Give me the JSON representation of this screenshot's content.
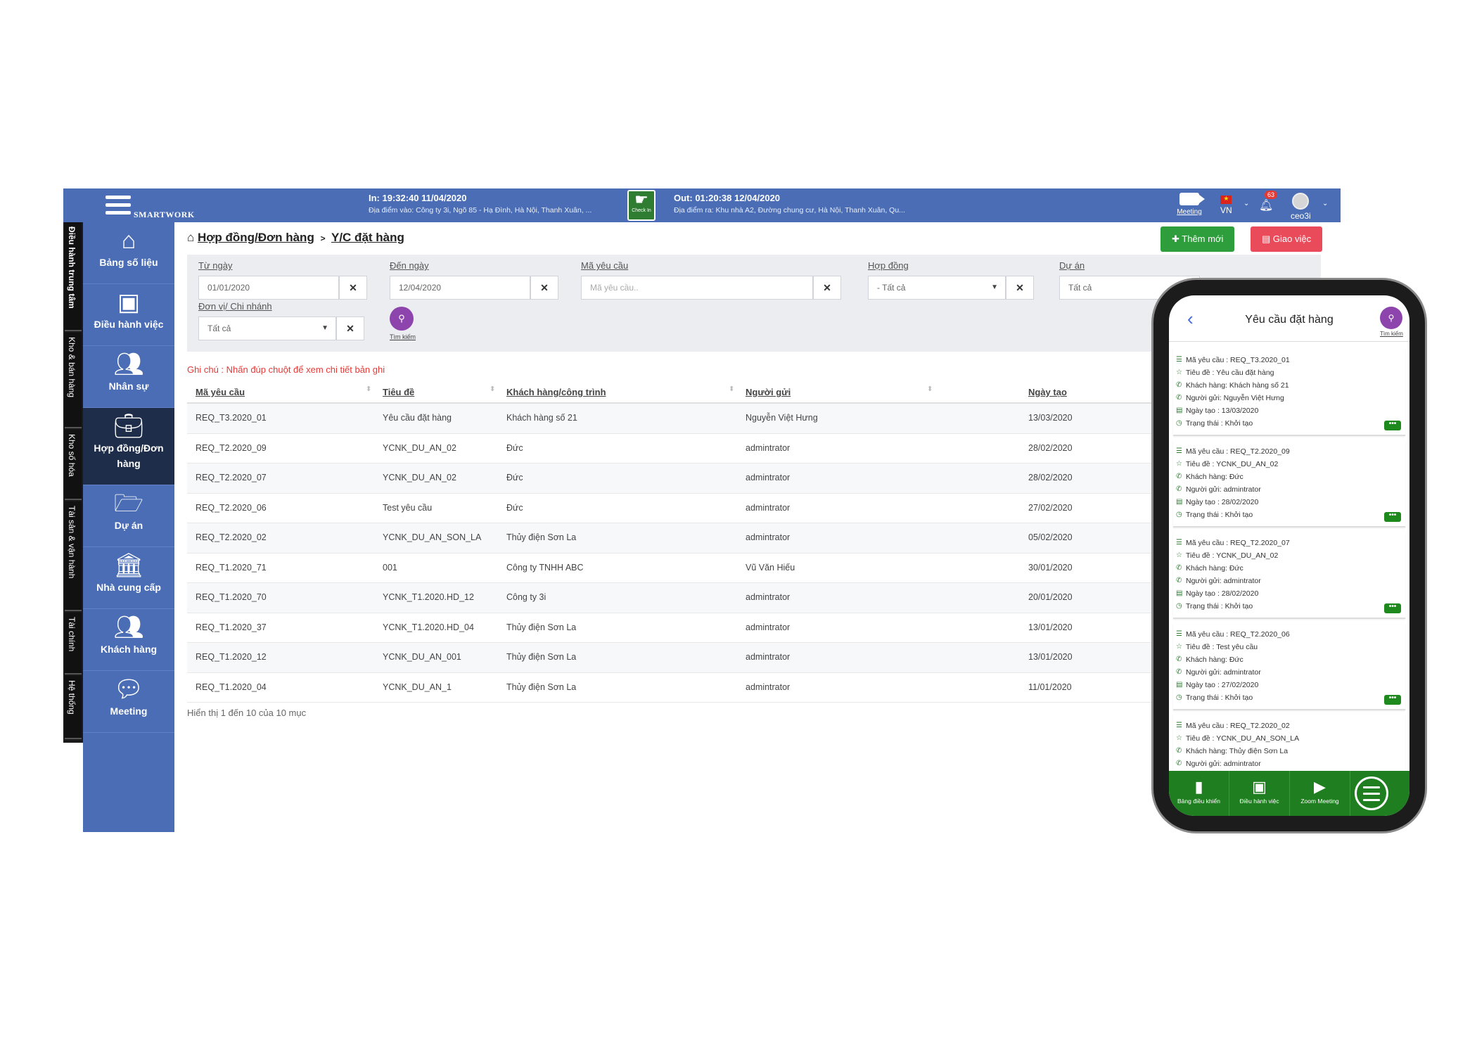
{
  "header": {
    "brand": "SMARTWORK",
    "checkin_in": "In: 19:32:40 11/04/2020",
    "checkin_in_place": "Địa điểm vào: Công ty 3i, Ngõ 85 - Hạ Đình, Hà Nội, Thanh Xuân, ...",
    "checkin_button": "Check In",
    "checkout_out": "Out: 01:20:38 12/04/2020",
    "checkout_place": "Địa điểm ra: Khu nhà A2, Đường chung cư, Hà Nội, Thanh Xuân, Qu...",
    "meeting": "Meeting",
    "lang": "VN",
    "notifications": "63",
    "user": "ceo3i"
  },
  "vertical_tabs": [
    "Điều hành trung tâm",
    "Kho & bán hàng",
    "Kho số hóa",
    "Tài sản & vận hành",
    "Tài chính",
    "Hệ thống"
  ],
  "sidebar": {
    "items": [
      {
        "label": "Bảng số liệu",
        "icon": "home-icon"
      },
      {
        "label": "Điều hành việc",
        "icon": "board-icon"
      },
      {
        "label": "Nhân sự",
        "icon": "users-icon"
      },
      {
        "label": "Hợp đồng/Đơn hàng",
        "icon": "briefcase-icon"
      },
      {
        "label": "Dự án",
        "icon": "folder-icon"
      },
      {
        "label": "Nhà cung cấp",
        "icon": "bank-icon"
      },
      {
        "label": "Khách hàng",
        "icon": "customers-icon"
      },
      {
        "label": "Meeting",
        "icon": "chat-icon"
      }
    ]
  },
  "breadcrumb": {
    "parent": "Hợp đồng/Đơn hàng",
    "current": "Y/C đặt hàng"
  },
  "actions": {
    "add": "Thêm mới",
    "assign": "Giao việc"
  },
  "filters": {
    "from_date_label": "Từ ngày",
    "from_date_value": "01/01/2020",
    "to_date_label": "Đến ngày",
    "to_date_value": "12/04/2020",
    "code_label": "Mã yêu cầu",
    "code_placeholder": "Mã yêu cầu..",
    "contract_label": "Hợp đồng",
    "contract_value": "- Tất cả",
    "project_label": "Dự án",
    "project_value": "Tất cả",
    "unit_label": "Đơn vị/ Chi nhánh",
    "unit_value": "Tất cả",
    "search_label": "Tìm kiếm"
  },
  "note": "Ghi chú : Nhấn đúp chuột để xem chi tiết bản ghi",
  "table": {
    "headers": [
      "Mã yêu cầu",
      "Tiêu đề",
      "Khách hàng/công trình",
      "Người gửi",
      "Ngày tạo"
    ],
    "rows": [
      [
        "REQ_T3.2020_01",
        "Yêu cầu đặt hàng",
        "Khách hàng số 21",
        "Nguyễn Việt Hưng",
        "13/03/2020"
      ],
      [
        "REQ_T2.2020_09",
        "YCNK_DU_AN_02",
        "Đức",
        "admintrator",
        "28/02/2020"
      ],
      [
        "REQ_T2.2020_07",
        "YCNK_DU_AN_02",
        "Đức",
        "admintrator",
        "28/02/2020"
      ],
      [
        "REQ_T2.2020_06",
        "Test yêu cầu",
        "Đức",
        "admintrator",
        "27/02/2020"
      ],
      [
        "REQ_T2.2020_02",
        "YCNK_DU_AN_SON_LA",
        "Thủy điện Sơn La",
        "admintrator",
        "05/02/2020"
      ],
      [
        "REQ_T1.2020_71",
        "001",
        "Công ty TNHH ABC",
        "Vũ Văn Hiếu",
        "30/01/2020"
      ],
      [
        "REQ_T1.2020_70",
        "YCNK_T1.2020.HD_12",
        "Công ty 3i",
        "admintrator",
        "20/01/2020"
      ],
      [
        "REQ_T1.2020_37",
        "YCNK_T1.2020.HD_04",
        "Thủy điện Sơn La",
        "admintrator",
        "13/01/2020"
      ],
      [
        "REQ_T1.2020_12",
        "YCNK_DU_AN_001",
        "Thủy điện Sơn La",
        "admintrator",
        "13/01/2020"
      ],
      [
        "REQ_T1.2020_04",
        "YCNK_DU_AN_1",
        "Thủy điện Sơn La",
        "admintrator",
        "11/01/2020"
      ]
    ]
  },
  "footer": "Hiển thị 1 đến 10 của 10 mục",
  "phone": {
    "title": "Yêu cầu đặt hàng",
    "search_label": "Tìm kiếm",
    "cards": [
      [
        "Mã yêu cầu : REQ_T3.2020_01",
        "Tiêu đề : Yêu cầu đặt hàng",
        "Khách hàng: Khách hàng số 21",
        "Người gửi: Nguyễn Việt Hưng",
        "Ngày tạo : 13/03/2020",
        "Trạng thái : Khởi tạo"
      ],
      [
        "Mã yêu cầu : REQ_T2.2020_09",
        "Tiêu đề : YCNK_DU_AN_02",
        "Khách hàng: Đức",
        "Người gửi: admintrator",
        "Ngày tạo : 28/02/2020",
        "Trạng thái : Khởi tạo"
      ],
      [
        "Mã yêu cầu : REQ_T2.2020_07",
        "Tiêu đề : YCNK_DU_AN_02",
        "Khách hàng: Đức",
        "Người gửi: admintrator",
        "Ngày tạo : 28/02/2020",
        "Trạng thái : Khởi tạo"
      ],
      [
        "Mã yêu cầu : REQ_T2.2020_06",
        "Tiêu đề : Test yêu cầu",
        "Khách hàng: Đức",
        "Người gửi: admintrator",
        "Ngày tạo : 27/02/2020",
        "Trạng thái : Khởi tạo"
      ],
      [
        "Mã yêu cầu : REQ_T2.2020_02",
        "Tiêu đề : YCNK_DU_AN_SON_LA",
        "Khách hàng: Thủy điện Sơn La",
        "Người gửi: admintrator"
      ]
    ],
    "nav": [
      "Bảng điều khiển",
      "Điều hành việc",
      "Zoom Meeting"
    ]
  }
}
